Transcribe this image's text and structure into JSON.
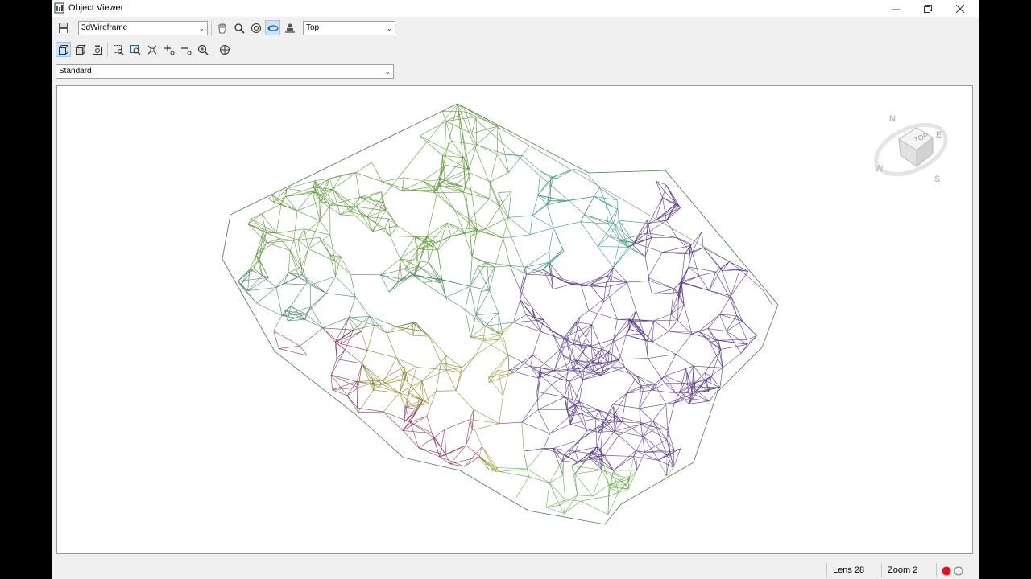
{
  "window": {
    "title": "Object Viewer"
  },
  "toolbar": {
    "visual_style": "3dWireframe",
    "view": "Top",
    "ucs": "Standard"
  },
  "viewcube": {
    "face": "TOP",
    "north": "N",
    "south": "S",
    "east": "E",
    "west": "W"
  },
  "status": {
    "lens": "Lens 28",
    "zoom": "Zoom 2"
  },
  "colors": {
    "accent": "#cce4f7",
    "record": "#e81123"
  }
}
